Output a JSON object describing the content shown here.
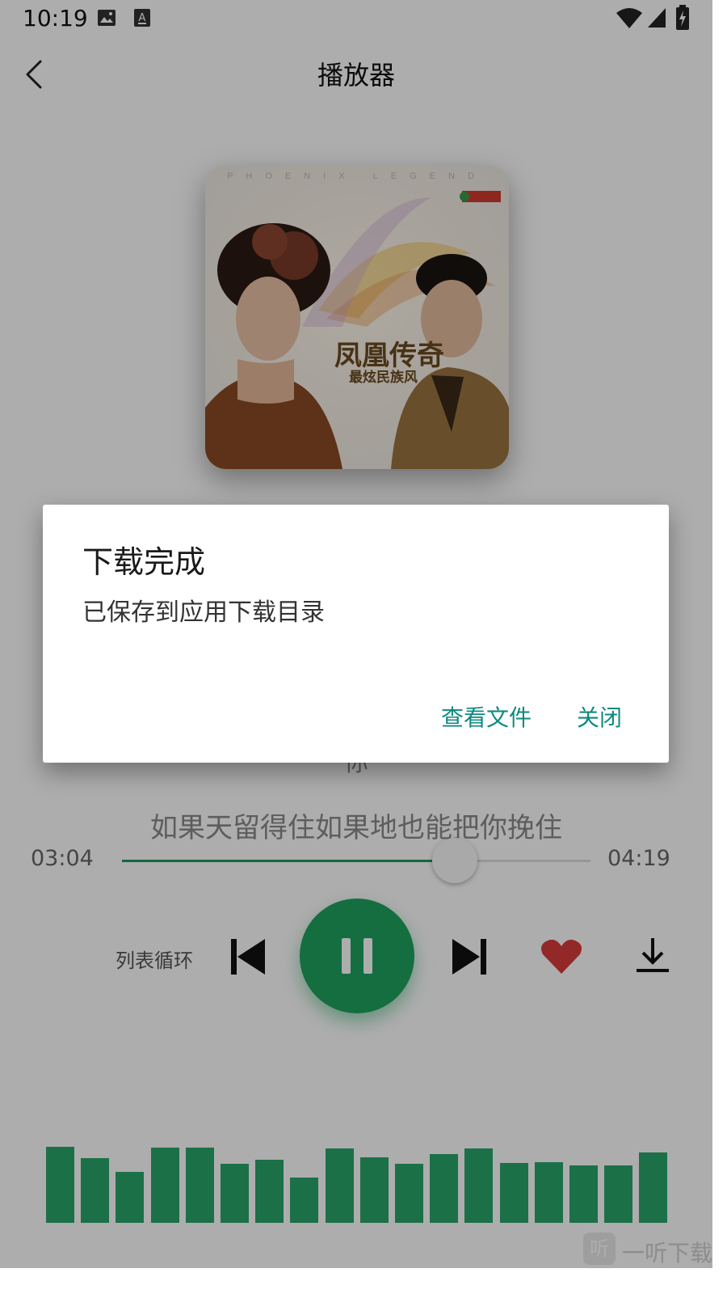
{
  "status_bar": {
    "time": "10:19",
    "icons": [
      "image-notification-icon",
      "text-notification-icon",
      "wifi-icon",
      "cell-signal-icon",
      "battery-charging-icon"
    ]
  },
  "header": {
    "title": "播放器",
    "back_icon": "chevron-left-icon"
  },
  "album": {
    "caption": "PHOENIX LEGEND",
    "title": "凤凰传奇",
    "subtitle": "最炫民族风"
  },
  "lyrics": {
    "previous_line": "你",
    "current_line": "如果天留得住如果地也能把你挽住"
  },
  "progress": {
    "elapsed": "03:04",
    "total": "04:19",
    "fraction": 0.71
  },
  "controls": {
    "mode_label": "列表循环",
    "state": "playing",
    "favorite": true,
    "accent_color": "#1ea35f",
    "favorite_color": "#d93b3b"
  },
  "visualizer": {
    "levels": [
      0.84,
      0.71,
      0.56,
      0.83,
      0.83,
      0.65,
      0.7,
      0.5,
      0.82,
      0.72,
      0.65,
      0.76,
      0.82,
      0.66,
      0.67,
      0.63,
      0.63,
      0.78
    ],
    "color": "#2aa56a"
  },
  "watermark": {
    "icon_glyph": "听",
    "text": "一听下载"
  },
  "dialog": {
    "title": "下载完成",
    "message": "已保存到应用下载目录",
    "view_button": "查看文件",
    "close_button": "关闭",
    "button_color": "#0f8a80"
  }
}
